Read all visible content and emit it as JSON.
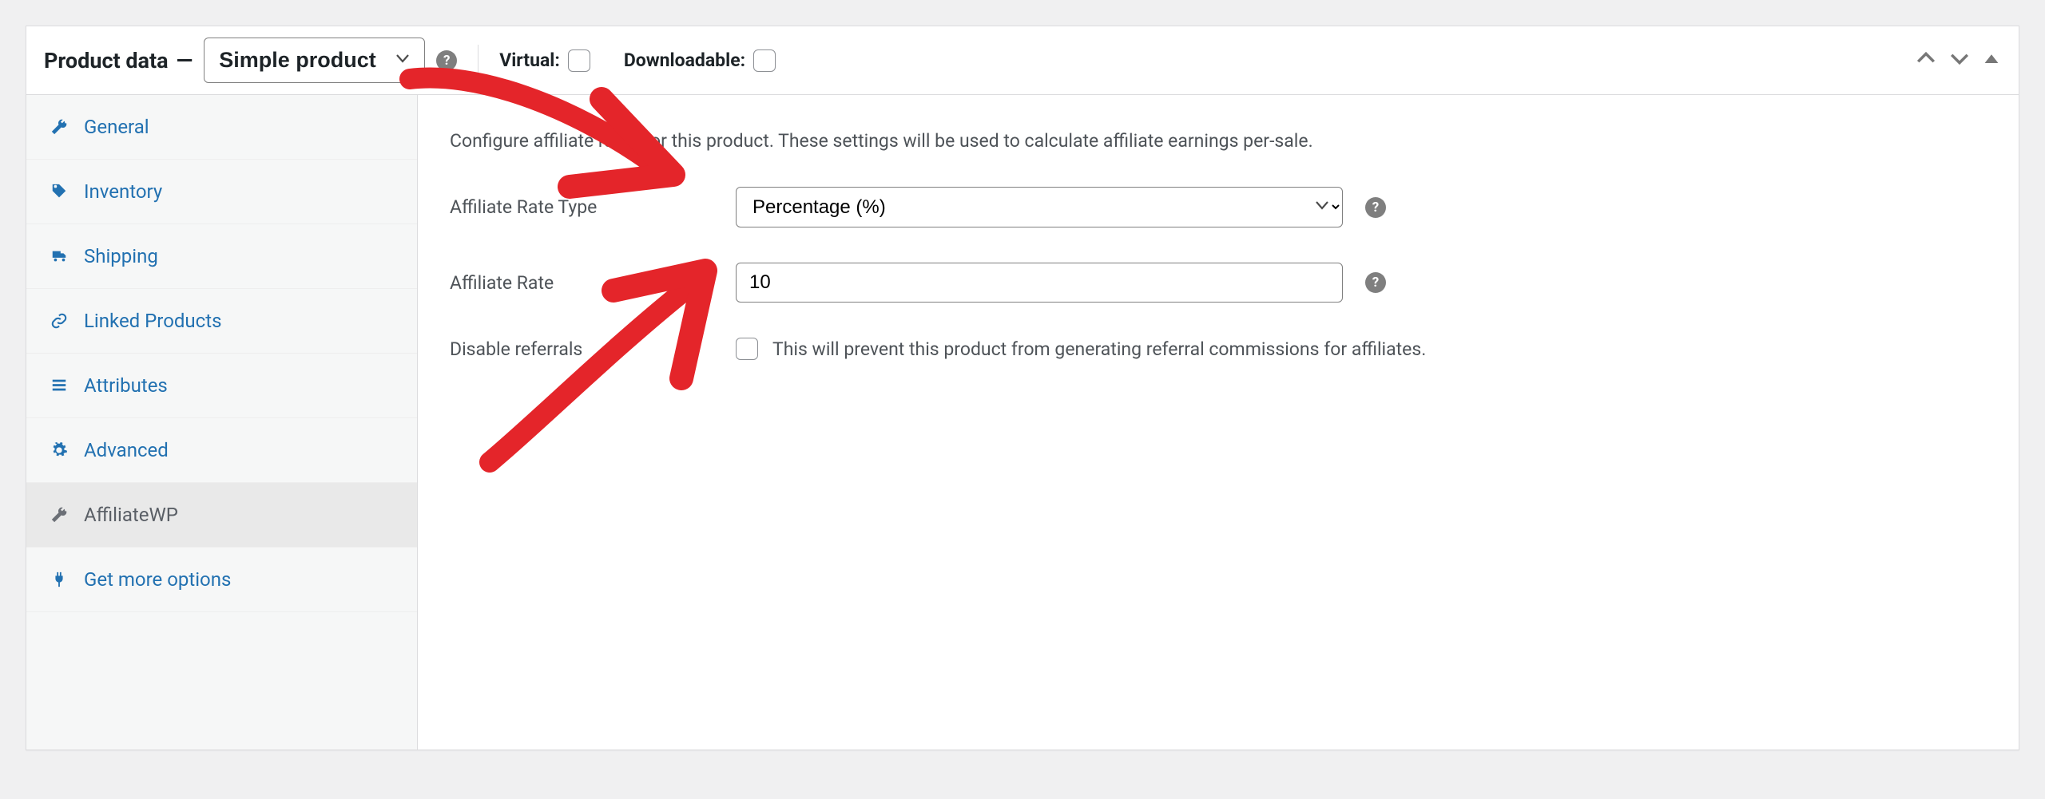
{
  "header": {
    "panel_title": "Product data",
    "dash": "—",
    "product_type_selected": "Simple product",
    "virtual_label": "Virtual:",
    "downloadable_label": "Downloadable:"
  },
  "tabs": [
    {
      "key": "general",
      "label": "General",
      "icon": "wrench"
    },
    {
      "key": "inventory",
      "label": "Inventory",
      "icon": "tag"
    },
    {
      "key": "shipping",
      "label": "Shipping",
      "icon": "truck"
    },
    {
      "key": "linked",
      "label": "Linked Products",
      "icon": "link"
    },
    {
      "key": "attributes",
      "label": "Attributes",
      "icon": "list"
    },
    {
      "key": "advanced",
      "label": "Advanced",
      "icon": "gear"
    },
    {
      "key": "affiliatewp",
      "label": "AffiliateWP",
      "icon": "wrench",
      "active": true
    },
    {
      "key": "more",
      "label": "Get more options",
      "icon": "plug"
    }
  ],
  "affiliatewp_panel": {
    "intro": "Configure affiliate rates for this product. These settings will be used to calculate affiliate earnings per-sale.",
    "rate_type_label": "Affiliate Rate Type",
    "rate_type_value": "Percentage (%)",
    "rate_label": "Affiliate Rate",
    "rate_value": "10",
    "disable_label": "Disable referrals",
    "disable_description": "This will prevent this product from generating referral commissions for affiliates."
  },
  "annotations_color": "#e4252a"
}
